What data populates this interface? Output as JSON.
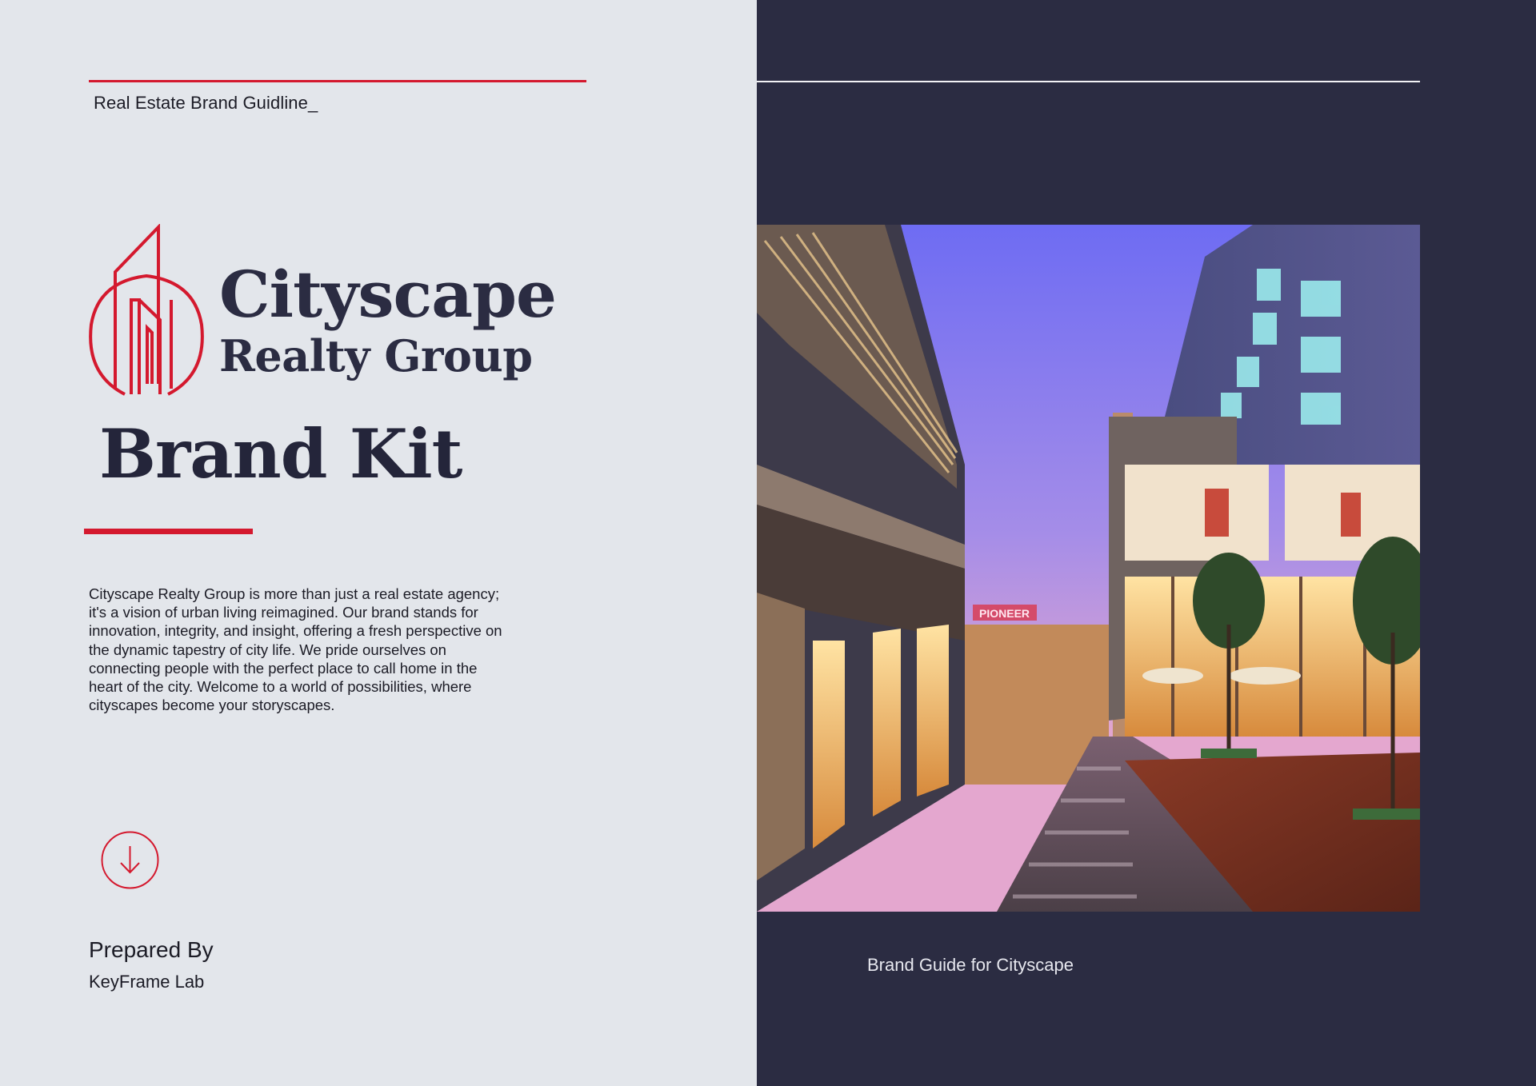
{
  "header": {
    "label": "Real Estate Brand Guidline_"
  },
  "logo": {
    "icon": "building-logo-icon",
    "title": "Cityscape",
    "subtitle": "Realty Group"
  },
  "main": {
    "title": "Brand Kit",
    "description": "Cityscape Realty Group is more than just a real estate agency; it's a vision of urban living reimagined. Our brand stands for innovation, integrity, and insight, offering a fresh perspective on the dynamic tapestry of city life. We pride ourselves on connecting people with the perfect place to call home in the heart of the city. Welcome to a world of possibilities, where cityscapes become your storyscapes.",
    "scroll_icon": "arrow-down-circle-icon"
  },
  "footer": {
    "prepared_label": "Prepared By",
    "prepared_value": "KeyFrame Lab"
  },
  "right": {
    "image_sign": "PIONEER",
    "caption": "Brand Guide for Cityscape"
  },
  "colors": {
    "accent_red": "#d4192e",
    "navy": "#2b2c42",
    "light_bg": "#e3e6eb"
  }
}
